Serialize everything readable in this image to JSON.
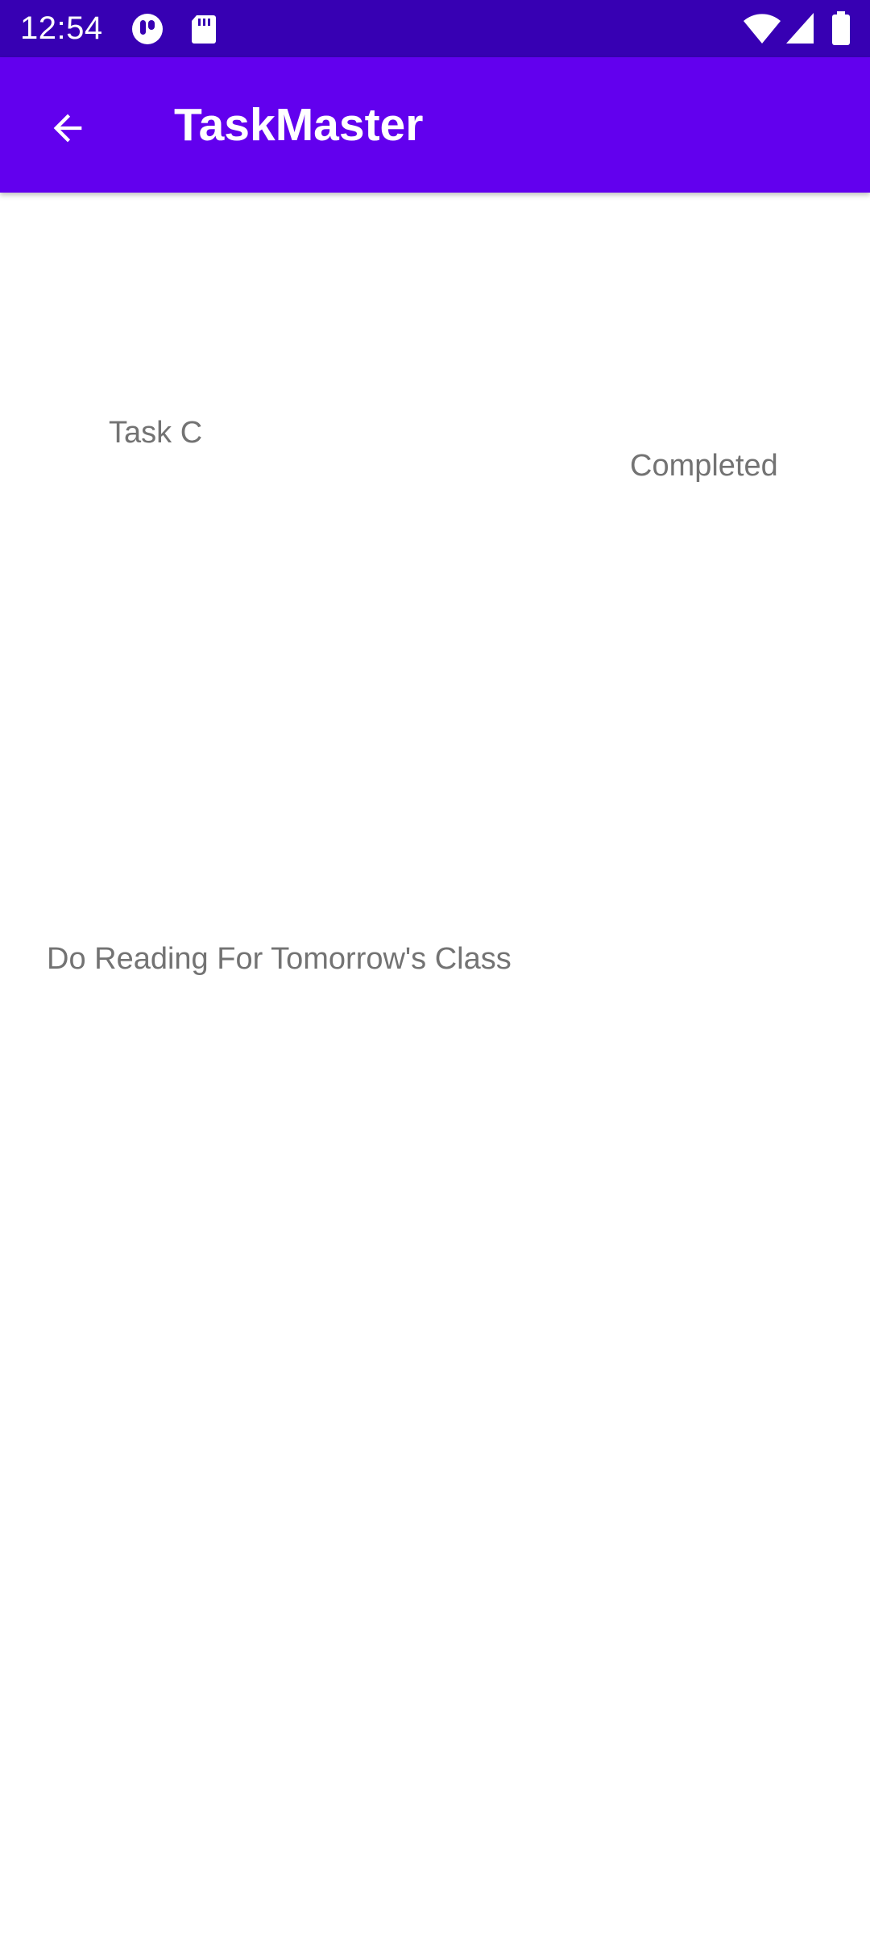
{
  "status_bar": {
    "time": "12:54",
    "icons": [
      "notification-app-icon",
      "sd-card-icon",
      "wifi-icon",
      "signal-icon",
      "battery-icon"
    ]
  },
  "app_bar": {
    "title": "TaskMaster",
    "back_icon": "arrow-back-icon"
  },
  "task": {
    "title": "Task C",
    "status": "Completed",
    "description": "Do Reading For Tomorrow's Class"
  },
  "colors": {
    "status_bar": "#3700b3",
    "app_bar": "#6200ee",
    "text_secondary": "#737373"
  }
}
